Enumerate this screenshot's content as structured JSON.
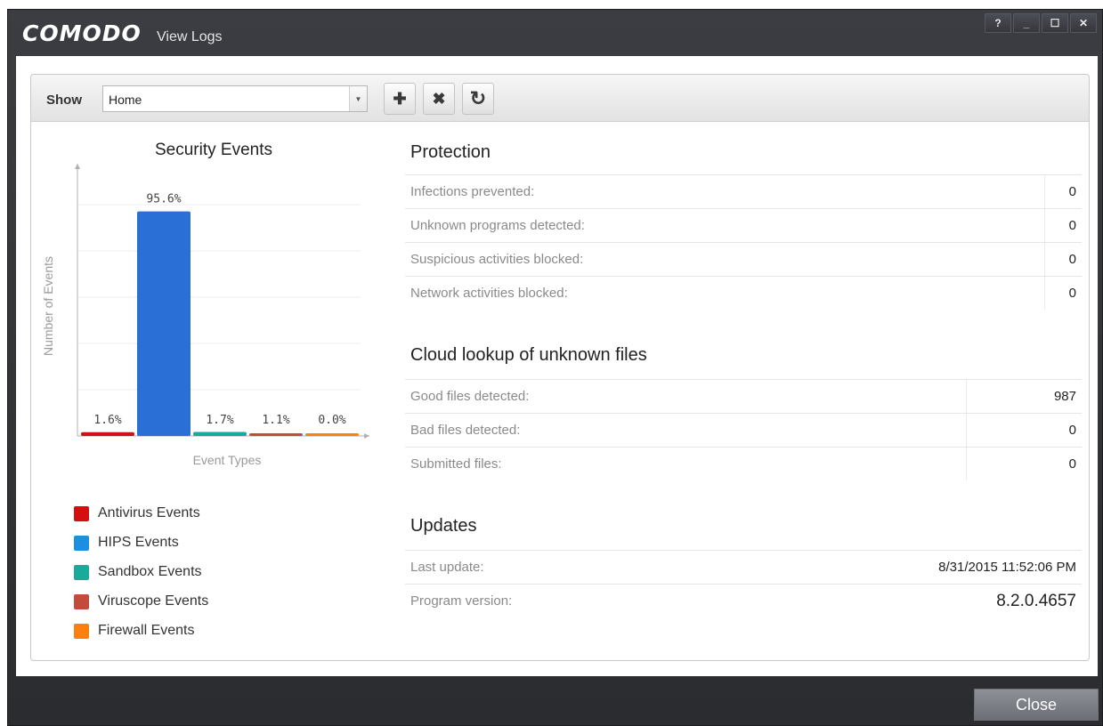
{
  "window": {
    "brand": "COMODO",
    "title": "View Logs",
    "controls": {
      "help": "?",
      "minimize": "_",
      "maximize": "☐",
      "close": "✕"
    }
  },
  "toolbar": {
    "show_label": "Show",
    "show_value": "Home",
    "add_glyph": "✚",
    "delete_glyph": "✖",
    "refresh_glyph": "↻"
  },
  "chart": {
    "title": "Security Events",
    "legend": [
      {
        "label": "Antivirus Events",
        "color": "#d40f12"
      },
      {
        "label": "HIPS Events",
        "color": "#1e8fe0"
      },
      {
        "label": "Sandbox Events",
        "color": "#1aaa9b"
      },
      {
        "label": "Viruscope Events",
        "color": "#c44a3c"
      },
      {
        "label": "Firewall Events",
        "color": "#ff7f0e"
      }
    ]
  },
  "chart_data": {
    "type": "bar",
    "title": "Security Events",
    "xlabel": "Event Types",
    "ylabel": "Number of Events",
    "categories": [
      "Antivirus Events",
      "HIPS Events",
      "Sandbox Events",
      "Viruscope Events",
      "Firewall Events"
    ],
    "values": [
      1.6,
      95.6,
      1.7,
      1.1,
      0.0
    ],
    "data_labels": [
      "1.6%",
      "95.6%",
      "1.7%",
      "1.1%",
      "0.0%"
    ],
    "colors": [
      "#d40f12",
      "#2a6fd6",
      "#1aaa9b",
      "#c44a3c",
      "#ff7f0e"
    ],
    "ylim": [
      0,
      100
    ],
    "grid": true
  },
  "protection": {
    "title": "Protection",
    "rows": [
      {
        "label": "Infections prevented:",
        "value": "0"
      },
      {
        "label": "Unknown programs detected:",
        "value": "0"
      },
      {
        "label": "Suspicious activities blocked:",
        "value": "0"
      },
      {
        "label": "Network activities blocked:",
        "value": "0"
      }
    ]
  },
  "cloud": {
    "title": "Cloud lookup of unknown files",
    "rows": [
      {
        "label": "Good files detected:",
        "value": "987"
      },
      {
        "label": "Bad files detected:",
        "value": "0"
      },
      {
        "label": "Submitted files:",
        "value": "0"
      }
    ]
  },
  "updates": {
    "title": "Updates",
    "rows": [
      {
        "label": "Last update:",
        "value": "8/31/2015 11:52:06 PM"
      },
      {
        "label": "Program version:",
        "value": "8.2.0.4657"
      }
    ]
  },
  "footer": {
    "close_label": "Close"
  }
}
